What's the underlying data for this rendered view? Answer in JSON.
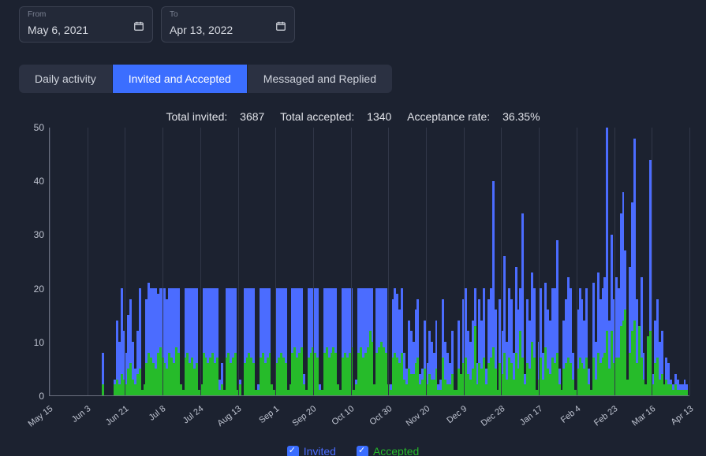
{
  "date_range": {
    "from_label": "From",
    "from_value": "May 6, 2021",
    "to_label": "To",
    "to_value": "Apr 13, 2022"
  },
  "tabs": {
    "items": [
      {
        "label": "Daily activity",
        "active": false
      },
      {
        "label": "Invited and Accepted",
        "active": true
      },
      {
        "label": "Messaged and Replied",
        "active": false
      }
    ]
  },
  "stats": {
    "total_invited_label": "Total invited:",
    "total_invited_value": "3687",
    "total_accepted_label": "Total accepted:",
    "total_accepted_value": "1340",
    "acceptance_label": "Acceptance rate:",
    "acceptance_value": "36.35%"
  },
  "legend": {
    "invited": "Invited",
    "accepted": "Accepted"
  },
  "chart_data": {
    "type": "bar",
    "title": "",
    "xlabel": "",
    "ylabel": "",
    "ylim": [
      0,
      50
    ],
    "yticks": [
      0,
      10,
      20,
      30,
      40,
      50
    ],
    "xticks": [
      "May 15",
      "Jun 3",
      "Jun 21",
      "Jul 8",
      "Jul 24",
      "Aug 13",
      "Sep 1",
      "Sep 20",
      "Oct 10",
      "Oct 30",
      "Nov 20",
      "Dec 9",
      "Dec 28",
      "Jan 17",
      "Feb 4",
      "Feb 23",
      "Mar 16",
      "Apr 13"
    ],
    "legend_position": "bottom",
    "series": [
      {
        "name": "Invited",
        "color": "#4b6cff"
      },
      {
        "name": "Accepted",
        "color": "#26bb2a"
      }
    ],
    "data": [
      {
        "inv": 0,
        "acc": 0
      },
      {
        "inv": 0,
        "acc": 0
      },
      {
        "inv": 0,
        "acc": 0
      },
      {
        "inv": 0,
        "acc": 0
      },
      {
        "inv": 0,
        "acc": 0
      },
      {
        "inv": 0,
        "acc": 0
      },
      {
        "inv": 0,
        "acc": 0
      },
      {
        "inv": 0,
        "acc": 0
      },
      {
        "inv": 0,
        "acc": 0
      },
      {
        "inv": 0,
        "acc": 0
      },
      {
        "inv": 0,
        "acc": 0
      },
      {
        "inv": 0,
        "acc": 0
      },
      {
        "inv": 0,
        "acc": 0
      },
      {
        "inv": 0,
        "acc": 0
      },
      {
        "inv": 0,
        "acc": 0
      },
      {
        "inv": 0,
        "acc": 0
      },
      {
        "inv": 0,
        "acc": 0
      },
      {
        "inv": 0,
        "acc": 0
      },
      {
        "inv": 0,
        "acc": 0
      },
      {
        "inv": 0,
        "acc": 0
      },
      {
        "inv": 0,
        "acc": 0
      },
      {
        "inv": 0,
        "acc": 0
      },
      {
        "inv": 0,
        "acc": 0
      },
      {
        "inv": 8,
        "acc": 2
      },
      {
        "inv": 0,
        "acc": 0
      },
      {
        "inv": 0,
        "acc": 0
      },
      {
        "inv": 0,
        "acc": 0
      },
      {
        "inv": 0,
        "acc": 0
      },
      {
        "inv": 3,
        "acc": 2
      },
      {
        "inv": 14,
        "acc": 3
      },
      {
        "inv": 10,
        "acc": 2
      },
      {
        "inv": 20,
        "acc": 4
      },
      {
        "inv": 12,
        "acc": 3
      },
      {
        "inv": 8,
        "acc": 2
      },
      {
        "inv": 15,
        "acc": 5
      },
      {
        "inv": 18,
        "acc": 6
      },
      {
        "inv": 10,
        "acc": 3
      },
      {
        "inv": 5,
        "acc": 2
      },
      {
        "inv": 12,
        "acc": 4
      },
      {
        "inv": 20,
        "acc": 5
      },
      {
        "inv": 0,
        "acc": 1
      },
      {
        "inv": 0,
        "acc": 2
      },
      {
        "inv": 18,
        "acc": 6
      },
      {
        "inv": 21,
        "acc": 8
      },
      {
        "inv": 20,
        "acc": 7
      },
      {
        "inv": 20,
        "acc": 6
      },
      {
        "inv": 20,
        "acc": 5
      },
      {
        "inv": 19,
        "acc": 8
      },
      {
        "inv": 20,
        "acc": 9
      },
      {
        "inv": 20,
        "acc": 7
      },
      {
        "inv": 20,
        "acc": 6
      },
      {
        "inv": 18,
        "acc": 5
      },
      {
        "inv": 20,
        "acc": 8
      },
      {
        "inv": 20,
        "acc": 7
      },
      {
        "inv": 20,
        "acc": 6
      },
      {
        "inv": 20,
        "acc": 9
      },
      {
        "inv": 20,
        "acc": 8
      },
      {
        "inv": 0,
        "acc": 2
      },
      {
        "inv": 0,
        "acc": 1
      },
      {
        "inv": 20,
        "acc": 7
      },
      {
        "inv": 20,
        "acc": 8
      },
      {
        "inv": 20,
        "acc": 6
      },
      {
        "inv": 20,
        "acc": 7
      },
      {
        "inv": 20,
        "acc": 5
      },
      {
        "inv": 20,
        "acc": 6
      },
      {
        "inv": 0,
        "acc": 1
      },
      {
        "inv": 0,
        "acc": 2
      },
      {
        "inv": 20,
        "acc": 8
      },
      {
        "inv": 20,
        "acc": 7
      },
      {
        "inv": 20,
        "acc": 6
      },
      {
        "inv": 20,
        "acc": 7
      },
      {
        "inv": 20,
        "acc": 8
      },
      {
        "inv": 20,
        "acc": 6
      },
      {
        "inv": 20,
        "acc": 7
      },
      {
        "inv": 3,
        "acc": 1
      },
      {
        "inv": 6,
        "acc": 2
      },
      {
        "inv": 0,
        "acc": 1
      },
      {
        "inv": 20,
        "acc": 7
      },
      {
        "inv": 20,
        "acc": 8
      },
      {
        "inv": 20,
        "acc": 6
      },
      {
        "inv": 20,
        "acc": 7
      },
      {
        "inv": 20,
        "acc": 8
      },
      {
        "inv": 0,
        "acc": 1
      },
      {
        "inv": 3,
        "acc": 2
      },
      {
        "inv": 0,
        "acc": 0
      },
      {
        "inv": 20,
        "acc": 6
      },
      {
        "inv": 20,
        "acc": 7
      },
      {
        "inv": 20,
        "acc": 8
      },
      {
        "inv": 20,
        "acc": 7
      },
      {
        "inv": 20,
        "acc": 6
      },
      {
        "inv": 0,
        "acc": 1
      },
      {
        "inv": 2,
        "acc": 1
      },
      {
        "inv": 20,
        "acc": 7
      },
      {
        "inv": 20,
        "acc": 8
      },
      {
        "inv": 20,
        "acc": 6
      },
      {
        "inv": 20,
        "acc": 7
      },
      {
        "inv": 20,
        "acc": 8
      },
      {
        "inv": 0,
        "acc": 2
      },
      {
        "inv": 0,
        "acc": 1
      },
      {
        "inv": 20,
        "acc": 6
      },
      {
        "inv": 20,
        "acc": 7
      },
      {
        "inv": 20,
        "acc": 8
      },
      {
        "inv": 20,
        "acc": 7
      },
      {
        "inv": 20,
        "acc": 6
      },
      {
        "inv": 0,
        "acc": 1
      },
      {
        "inv": 0,
        "acc": 2
      },
      {
        "inv": 20,
        "acc": 8
      },
      {
        "inv": 20,
        "acc": 9
      },
      {
        "inv": 20,
        "acc": 7
      },
      {
        "inv": 20,
        "acc": 8
      },
      {
        "inv": 20,
        "acc": 9
      },
      {
        "inv": 4,
        "acc": 2
      },
      {
        "inv": 0,
        "acc": 1
      },
      {
        "inv": 20,
        "acc": 7
      },
      {
        "inv": 20,
        "acc": 8
      },
      {
        "inv": 20,
        "acc": 9
      },
      {
        "inv": 20,
        "acc": 8
      },
      {
        "inv": 20,
        "acc": 7
      },
      {
        "inv": 2,
        "acc": 1
      },
      {
        "inv": 0,
        "acc": 1
      },
      {
        "inv": 20,
        "acc": 8
      },
      {
        "inv": 20,
        "acc": 9
      },
      {
        "inv": 20,
        "acc": 7
      },
      {
        "inv": 20,
        "acc": 8
      },
      {
        "inv": 20,
        "acc": 9
      },
      {
        "inv": 20,
        "acc": 8
      },
      {
        "inv": 0,
        "acc": 2
      },
      {
        "inv": 0,
        "acc": 1
      },
      {
        "inv": 20,
        "acc": 7
      },
      {
        "inv": 20,
        "acc": 8
      },
      {
        "inv": 20,
        "acc": 7
      },
      {
        "inv": 20,
        "acc": 8
      },
      {
        "inv": 20,
        "acc": 9
      },
      {
        "inv": 0,
        "acc": 1
      },
      {
        "inv": 3,
        "acc": 2
      },
      {
        "inv": 20,
        "acc": 8
      },
      {
        "inv": 20,
        "acc": 9
      },
      {
        "inv": 20,
        "acc": 7
      },
      {
        "inv": 20,
        "acc": 8
      },
      {
        "inv": 20,
        "acc": 9
      },
      {
        "inv": 20,
        "acc": 12
      },
      {
        "inv": 20,
        "acc": 10
      },
      {
        "inv": 0,
        "acc": 2
      },
      {
        "inv": 20,
        "acc": 8
      },
      {
        "inv": 20,
        "acc": 9
      },
      {
        "inv": 20,
        "acc": 10
      },
      {
        "inv": 20,
        "acc": 9
      },
      {
        "inv": 20,
        "acc": 8
      },
      {
        "inv": 0,
        "acc": 2
      },
      {
        "inv": 2,
        "acc": 1
      },
      {
        "inv": 18,
        "acc": 7
      },
      {
        "inv": 20,
        "acc": 8
      },
      {
        "inv": 19,
        "acc": 7
      },
      {
        "inv": 16,
        "acc": 6
      },
      {
        "inv": 20,
        "acc": 8
      },
      {
        "inv": 8,
        "acc": 3
      },
      {
        "inv": 5,
        "acc": 2
      },
      {
        "inv": 14,
        "acc": 5
      },
      {
        "inv": 12,
        "acc": 4
      },
      {
        "inv": 10,
        "acc": 4
      },
      {
        "inv": 16,
        "acc": 6
      },
      {
        "inv": 18,
        "acc": 7
      },
      {
        "inv": 4,
        "acc": 2
      },
      {
        "inv": 5,
        "acc": 3
      },
      {
        "inv": 14,
        "acc": 5
      },
      {
        "inv": 6,
        "acc": 2
      },
      {
        "inv": 12,
        "acc": 4
      },
      {
        "inv": 10,
        "acc": 3
      },
      {
        "inv": 8,
        "acc": 3
      },
      {
        "inv": 14,
        "acc": 5
      },
      {
        "inv": 2,
        "acc": 1
      },
      {
        "inv": 3,
        "acc": 1
      },
      {
        "inv": 18,
        "acc": 7
      },
      {
        "inv": 10,
        "acc": 3
      },
      {
        "inv": 8,
        "acc": 2
      },
      {
        "inv": 6,
        "acc": 2
      },
      {
        "inv": 12,
        "acc": 4
      },
      {
        "inv": 0,
        "acc": 1
      },
      {
        "inv": 0,
        "acc": 1
      },
      {
        "inv": 14,
        "acc": 5
      },
      {
        "inv": 3,
        "acc": 4
      },
      {
        "inv": 18,
        "acc": 6
      },
      {
        "inv": 20,
        "acc": 7
      },
      {
        "inv": 12,
        "acc": 4
      },
      {
        "inv": 10,
        "acc": 3
      },
      {
        "inv": 14,
        "acc": 5
      },
      {
        "inv": 20,
        "acc": 13
      },
      {
        "inv": 6,
        "acc": 2
      },
      {
        "inv": 18,
        "acc": 6
      },
      {
        "inv": 14,
        "acc": 5
      },
      {
        "inv": 20,
        "acc": 7
      },
      {
        "inv": 5,
        "acc": 2
      },
      {
        "inv": 18,
        "acc": 6
      },
      {
        "inv": 20,
        "acc": 7
      },
      {
        "inv": 40,
        "acc": 9
      },
      {
        "inv": 16,
        "acc": 5
      },
      {
        "inv": 0,
        "acc": 1
      },
      {
        "inv": 18,
        "acc": 6
      },
      {
        "inv": 12,
        "acc": 4
      },
      {
        "inv": 26,
        "acc": 8
      },
      {
        "inv": 10,
        "acc": 3
      },
      {
        "inv": 20,
        "acc": 7
      },
      {
        "inv": 18,
        "acc": 6
      },
      {
        "inv": 8,
        "acc": 3
      },
      {
        "inv": 24,
        "acc": 8
      },
      {
        "inv": 16,
        "acc": 5
      },
      {
        "inv": 20,
        "acc": 12
      },
      {
        "inv": 34,
        "acc": 7
      },
      {
        "inv": 4,
        "acc": 2
      },
      {
        "inv": 18,
        "acc": 6
      },
      {
        "inv": 14,
        "acc": 5
      },
      {
        "inv": 23,
        "acc": 10
      },
      {
        "inv": 20,
        "acc": 7
      },
      {
        "inv": 0,
        "acc": 1
      },
      {
        "inv": 10,
        "acc": 3
      },
      {
        "inv": 20,
        "acc": 7
      },
      {
        "inv": 8,
        "acc": 3
      },
      {
        "inv": 21,
        "acc": 9
      },
      {
        "inv": 16,
        "acc": 5
      },
      {
        "inv": 14,
        "acc": 4
      },
      {
        "inv": 20,
        "acc": 7
      },
      {
        "inv": 20,
        "acc": 6
      },
      {
        "inv": 29,
        "acc": 8
      },
      {
        "inv": 5,
        "acc": 2
      },
      {
        "inv": 0,
        "acc": 1
      },
      {
        "inv": 14,
        "acc": 5
      },
      {
        "inv": 18,
        "acc": 6
      },
      {
        "inv": 22,
        "acc": 7
      },
      {
        "inv": 20,
        "acc": 6
      },
      {
        "inv": 8,
        "acc": 3
      },
      {
        "inv": 0,
        "acc": 1
      },
      {
        "inv": 16,
        "acc": 5
      },
      {
        "inv": 20,
        "acc": 7
      },
      {
        "inv": 18,
        "acc": 6
      },
      {
        "inv": 14,
        "acc": 5
      },
      {
        "inv": 20,
        "acc": 7
      },
      {
        "inv": 5,
        "acc": 2
      },
      {
        "inv": 0,
        "acc": 1
      },
      {
        "inv": 21,
        "acc": 7
      },
      {
        "inv": 10,
        "acc": 3
      },
      {
        "inv": 23,
        "acc": 8
      },
      {
        "inv": 18,
        "acc": 6
      },
      {
        "inv": 20,
        "acc": 7
      },
      {
        "inv": 22,
        "acc": 8
      },
      {
        "inv": 51,
        "acc": 12
      },
      {
        "inv": 14,
        "acc": 5
      },
      {
        "inv": 30,
        "acc": 12
      },
      {
        "inv": 18,
        "acc": 6
      },
      {
        "inv": 22,
        "acc": 7
      },
      {
        "inv": 20,
        "acc": 7
      },
      {
        "inv": 34,
        "acc": 13
      },
      {
        "inv": 38,
        "acc": 14
      },
      {
        "inv": 27,
        "acc": 16
      },
      {
        "inv": 0,
        "acc": 3
      },
      {
        "inv": 24,
        "acc": 8
      },
      {
        "inv": 36,
        "acc": 12
      },
      {
        "inv": 48,
        "acc": 14
      },
      {
        "inv": 18,
        "acc": 6
      },
      {
        "inv": 12,
        "acc": 13
      },
      {
        "inv": 22,
        "acc": 7
      },
      {
        "inv": 8,
        "acc": 3
      },
      {
        "inv": 0,
        "acc": 2
      },
      {
        "inv": 10,
        "acc": 11
      },
      {
        "inv": 44,
        "acc": 12
      },
      {
        "inv": 4,
        "acc": 2
      },
      {
        "inv": 14,
        "acc": 6
      },
      {
        "inv": 18,
        "acc": 7
      },
      {
        "inv": 10,
        "acc": 3
      },
      {
        "inv": 12,
        "acc": 4
      },
      {
        "inv": 0,
        "acc": 2
      },
      {
        "inv": 7,
        "acc": 3
      },
      {
        "inv": 6,
        "acc": 2
      },
      {
        "inv": 3,
        "acc": 2
      },
      {
        "inv": 2,
        "acc": 1
      },
      {
        "inv": 4,
        "acc": 2
      },
      {
        "inv": 3,
        "acc": 1
      },
      {
        "inv": 2,
        "acc": 1
      },
      {
        "inv": 2,
        "acc": 1
      },
      {
        "inv": 3,
        "acc": 1
      },
      {
        "inv": 2,
        "acc": 1
      }
    ]
  }
}
